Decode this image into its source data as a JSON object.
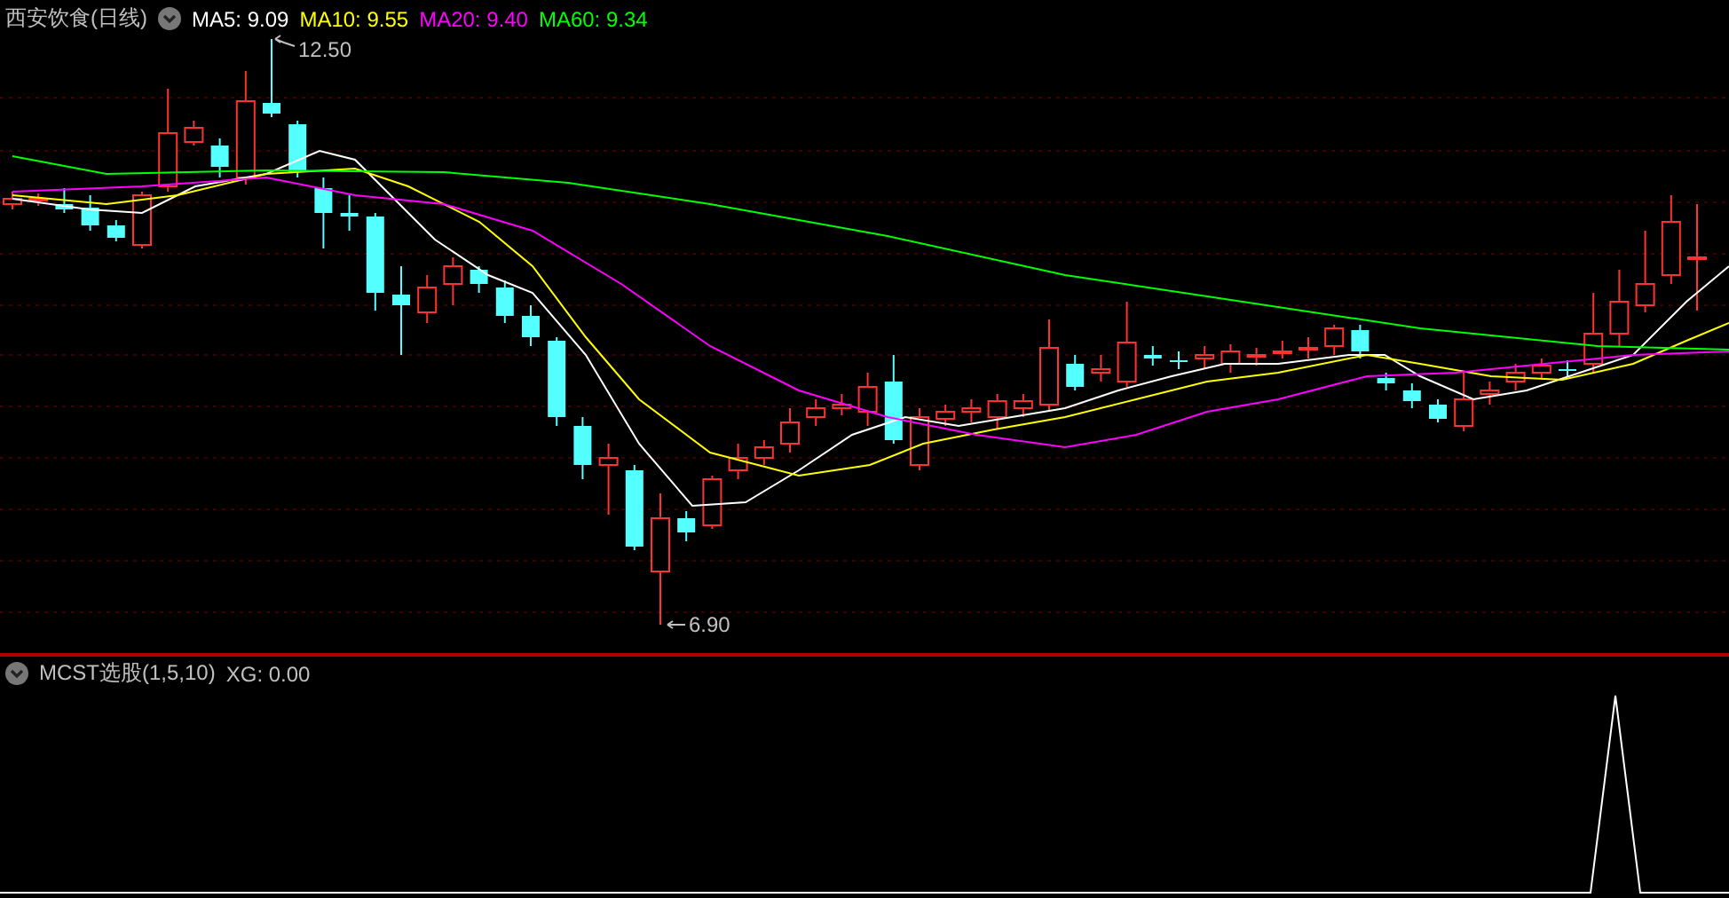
{
  "chart": {
    "title": "西安饮食(日线)",
    "indicators": [
      {
        "label": "MA5: 9.09",
        "color": "#ffffff"
      },
      {
        "label": "MA10: 9.55",
        "color": "#ffff00"
      },
      {
        "label": "MA20: 9.40",
        "color": "#ff00ff"
      },
      {
        "label": "MA60: 9.34",
        "color": "#00ff00"
      }
    ],
    "high_marker": "12.50",
    "low_marker": "6.90"
  },
  "sub_chart": {
    "title": "MCST选股(1,5,10)",
    "indicators": [
      {
        "label": "XG: 0.00",
        "color": "#c0c0c0"
      }
    ]
  }
}
